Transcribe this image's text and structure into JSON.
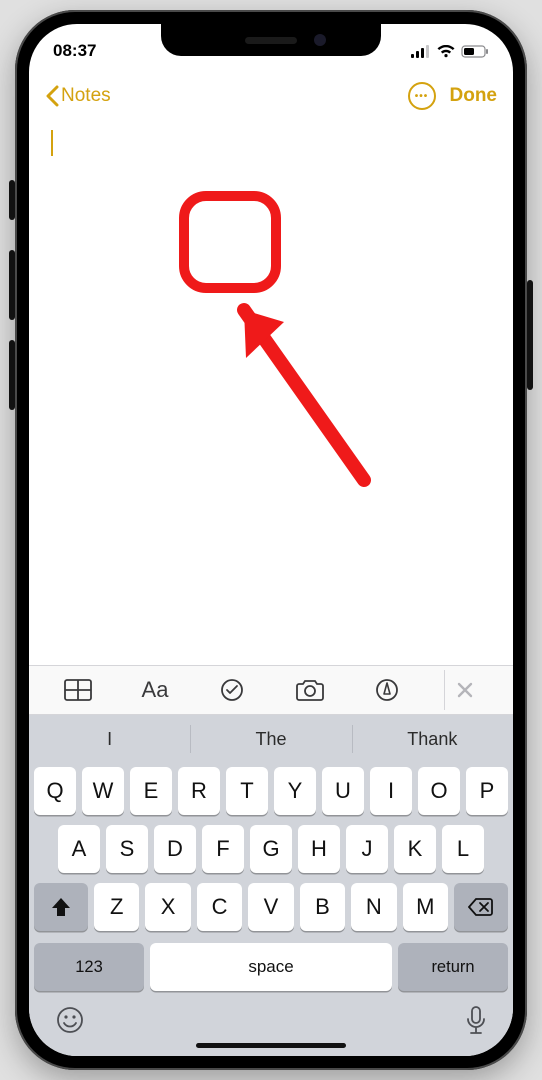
{
  "status": {
    "time": "08:37"
  },
  "nav": {
    "back_label": "Notes",
    "done_label": "Done"
  },
  "toolbar": {
    "items": [
      "table-icon",
      "format-icon",
      "checklist-icon",
      "camera-icon",
      "markup-icon"
    ],
    "format_label": "Aa"
  },
  "suggestions": [
    "I",
    "The",
    "Thank"
  ],
  "keyboard": {
    "row1": [
      "Q",
      "W",
      "E",
      "R",
      "T",
      "Y",
      "U",
      "I",
      "O",
      "P"
    ],
    "row2": [
      "A",
      "S",
      "D",
      "F",
      "G",
      "H",
      "J",
      "K",
      "L"
    ],
    "row3": [
      "Z",
      "X",
      "C",
      "V",
      "B",
      "N",
      "M"
    ],
    "numbers_label": "123",
    "space_label": "space",
    "return_label": "return"
  },
  "colors": {
    "accent": "#d4a20f",
    "annotation": "#ef1a1a"
  }
}
